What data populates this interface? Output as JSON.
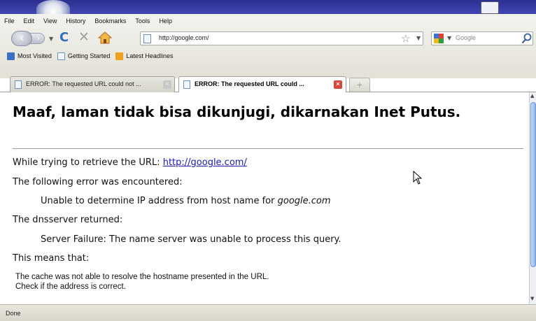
{
  "menu": [
    "File",
    "Edit",
    "View",
    "History",
    "Bookmarks",
    "Tools",
    "Help"
  ],
  "nav": {
    "url": "http://google.com/",
    "search_placeholder": "Google"
  },
  "bookmarks": [
    {
      "label": "Most Visited",
      "color": "#3b6fc4"
    },
    {
      "label": "Getting Started",
      "color": "#6b8fc0"
    },
    {
      "label": "Latest Headlines",
      "color": "#f0a020"
    }
  ],
  "tabs": [
    {
      "label": "ERROR: The requested URL could not ...",
      "active": false
    },
    {
      "label": "ERROR: The requested URL could ...",
      "active": true
    }
  ],
  "newtab_label": "+",
  "page": {
    "heading": "Maaf, laman tidak bisa dikunjugi, dikarnakan Inet Putus.",
    "retrieve_prefix": "While trying to retrieve the URL: ",
    "retrieve_url": "http://google.com/",
    "error_intro": "The following error was encountered:",
    "error_detail_prefix": "Unable to determine IP address from host name for ",
    "error_detail_host": "google.com",
    "dns_intro": "The dnsserver returned:",
    "dns_detail": "Server Failure: The name server was unable to process this query.",
    "means": "This means that:",
    "explain_1": "The cache was not able to resolve the hostname presented in the URL.",
    "explain_2": "Check if the address is correct."
  },
  "status": "Done"
}
